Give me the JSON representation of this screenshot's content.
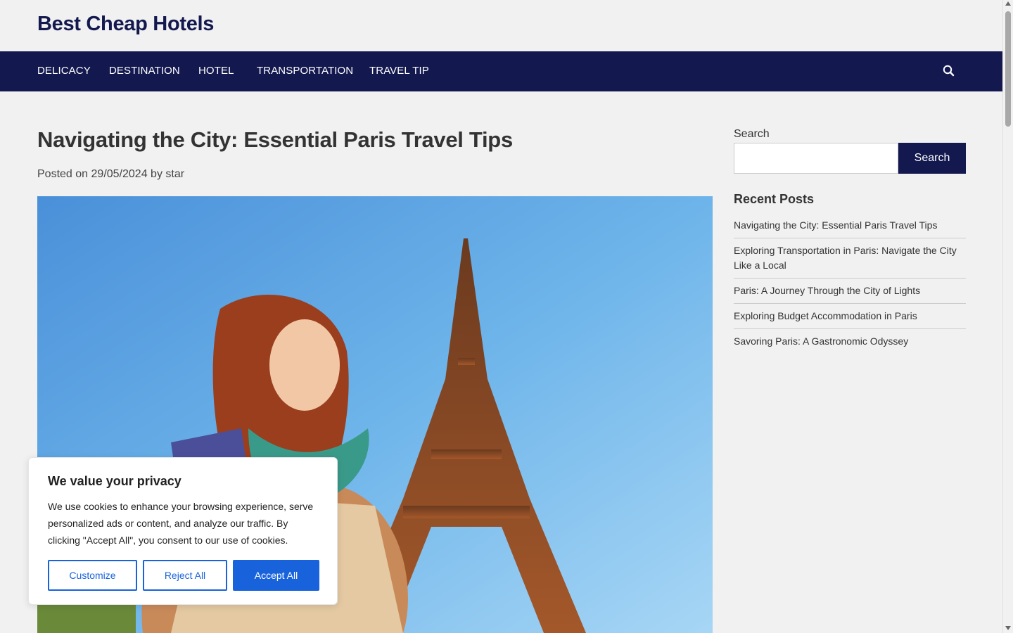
{
  "site": {
    "title": "Best Cheap Hotels"
  },
  "nav": {
    "items": [
      {
        "label": "DELICACY"
      },
      {
        "label": "DESTINATION"
      },
      {
        "label": "HOTEL"
      },
      {
        "label": "TRANSPORTATION"
      },
      {
        "label": "TRAVEL TIP"
      }
    ],
    "search_icon": "search-icon"
  },
  "post": {
    "title": "Navigating the City: Essential Paris Travel Tips",
    "meta_prefix": "Posted on",
    "date": "29/05/2024",
    "by": "by",
    "author": "star"
  },
  "sidebar": {
    "search_label": "Search",
    "search_value": "",
    "search_button": "Search",
    "recent_heading": "Recent Posts",
    "recent_posts": [
      "Navigating the City: Essential Paris Travel Tips",
      "Exploring Transportation in Paris: Navigate the City Like a Local",
      "Paris: A Journey Through the City of Lights",
      "Exploring Budget Accommodation in Paris",
      "Savoring Paris: A Gastronomic Odyssey"
    ]
  },
  "cookie": {
    "title": "We value your privacy",
    "text": "We use cookies to enhance your browsing experience, serve personalized ads or content, and analyze our traffic. By clicking \"Accept All\", you consent to our use of cookies.",
    "customize": "Customize",
    "reject": "Reject All",
    "accept": "Accept All"
  },
  "colors": {
    "nav_bg": "#13194f",
    "accent": "#1863dc",
    "page_bg": "#f1f1f1"
  }
}
